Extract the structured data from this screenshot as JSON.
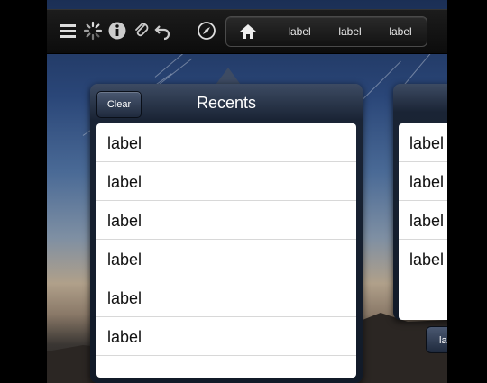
{
  "toolbar": {
    "icons": [
      "menu-icon",
      "activity-spinner-icon",
      "info-icon",
      "attachment-icon",
      "undo-icon",
      "compass-icon"
    ],
    "breadcrumb": {
      "home_icon": "home-icon",
      "items": [
        "label",
        "label",
        "label"
      ]
    }
  },
  "popover": {
    "title": "Recents",
    "clear_label": "Clear",
    "rows": [
      "label",
      "label",
      "label",
      "label",
      "label",
      "label"
    ]
  },
  "popover2": {
    "rows": [
      "label",
      "label",
      "label",
      "label"
    ],
    "button_label": "la"
  }
}
